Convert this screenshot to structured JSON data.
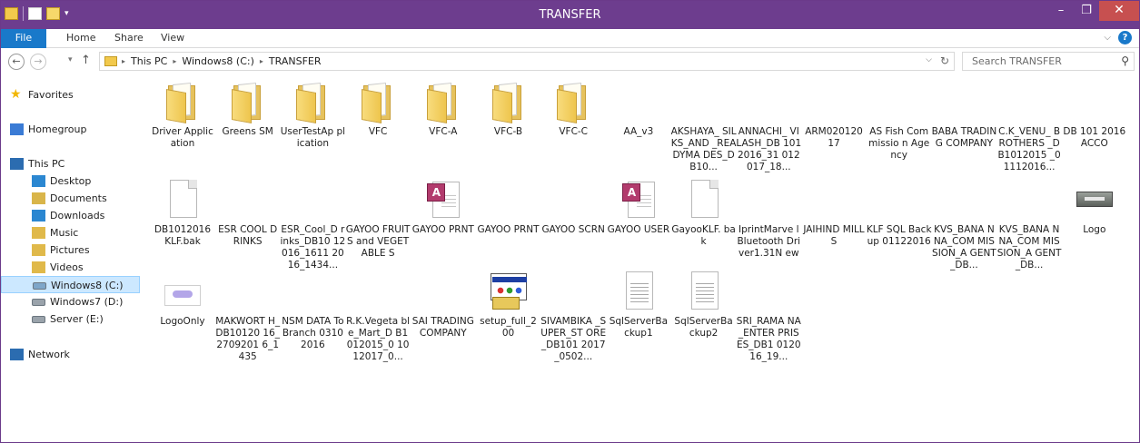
{
  "window": {
    "title": "TRANSFER",
    "minimize_glyph": "–",
    "maximize_glyph": "❐",
    "close_glyph": "✕"
  },
  "ribbon": {
    "file": "File",
    "tabs": [
      "Home",
      "Share",
      "View"
    ],
    "expand_glyph": "⌵",
    "help_glyph": "?"
  },
  "nav": {
    "back_glyph": "←",
    "forward_glyph": "→",
    "recent_glyph": "▾",
    "up_glyph": "↑"
  },
  "address": {
    "crumbs": [
      "This PC",
      "Windows8 (C:)",
      "TRANSFER"
    ],
    "separator_glyph": "▸",
    "dropdown_glyph": "⌵",
    "refresh_glyph": "↻"
  },
  "search": {
    "placeholder": "Search TRANSFER",
    "icon_glyph": "⚲"
  },
  "sidebar": {
    "items": [
      {
        "label": "Favorites",
        "icon": "star-icon",
        "color": "#f2b705"
      },
      {
        "label": "Homegroup",
        "icon": "homegroup-icon",
        "color": "#3a7bd5"
      },
      {
        "label": "This PC",
        "icon": "computer-icon",
        "color": "#2b6cb0"
      },
      {
        "label": "Desktop",
        "icon": "desktop-icon",
        "color": "#2b87d1"
      },
      {
        "label": "Documents",
        "icon": "documents-icon",
        "color": "#d9b54a"
      },
      {
        "label": "Downloads",
        "icon": "downloads-icon",
        "color": "#2b87d1"
      },
      {
        "label": "Music",
        "icon": "music-icon",
        "color": "#e0b94a"
      },
      {
        "label": "Pictures",
        "icon": "pictures-icon",
        "color": "#e0b94a"
      },
      {
        "label": "Videos",
        "icon": "videos-icon",
        "color": "#e0b94a"
      },
      {
        "label": "Windows8 (C:)",
        "icon": "drive-icon",
        "color": "#7fa6c9",
        "selected": true
      },
      {
        "label": "Windows7 (D:)",
        "icon": "drive-icon",
        "color": "#9aa3ab"
      },
      {
        "label": "Server (E:)",
        "icon": "drive-icon",
        "color": "#9aa3ab"
      },
      {
        "label": "Network",
        "icon": "network-icon",
        "color": "#2b6cb0"
      }
    ]
  },
  "files": [
    {
      "name": "Driver Application",
      "type": "folder"
    },
    {
      "name": "Greens SM",
      "type": "folder"
    },
    {
      "name": "UserTestAp plication",
      "type": "folder"
    },
    {
      "name": "VFC",
      "type": "folder"
    },
    {
      "name": "VFC-A",
      "type": "folder"
    },
    {
      "name": "VFC-B",
      "type": "folder"
    },
    {
      "name": "VFC-C",
      "type": "folder"
    },
    {
      "name": "AA_v3",
      "type": "archive"
    },
    {
      "name": "AKSHAYA_ SILKS_AND _READYMA DES_DB10...",
      "type": "archive"
    },
    {
      "name": "ANNACHI_ VILASH_DB 1012016_31 012017_18...",
      "type": "archive"
    },
    {
      "name": "ARM020120 17",
      "type": "archive"
    },
    {
      "name": "AS Fish Commissio n Agency",
      "type": "archive"
    },
    {
      "name": "BABA TRADING COMPANY",
      "type": "archive"
    },
    {
      "name": "C.K_VENU_ BROTHERS _DB1012015 _01112016...",
      "type": "archive"
    },
    {
      "name": "DB 101 2016 ACCO",
      "type": "archive"
    },
    {
      "name": "DB1012016 KLF.bak",
      "type": "bak"
    },
    {
      "name": "ESR COOL DRINKS",
      "type": "archive"
    },
    {
      "name": "ESR_Cool_D rinks_DB10 12016_1611 2016_1434...",
      "type": "archive"
    },
    {
      "name": "GAYOO FRUITS and VEGETABLE S",
      "type": "archive"
    },
    {
      "name": "GAYOO PRNT",
      "type": "access"
    },
    {
      "name": "GAYOO PRNT",
      "type": "archive"
    },
    {
      "name": "GAYOO SCRN",
      "type": "archive"
    },
    {
      "name": "GAYOO USER",
      "type": "access"
    },
    {
      "name": "GayooKLF. bak",
      "type": "bak"
    },
    {
      "name": "IprintMarve lBluetooth Driver1.31N ew",
      "type": "archive"
    },
    {
      "name": "JAIHIND MILLS",
      "type": "archive"
    },
    {
      "name": "KLF SQL Backup 01122016",
      "type": "archive"
    },
    {
      "name": "KVS_BANA NNA_COM MISSION_A GENT_DB...",
      "type": "archive"
    },
    {
      "name": "KVS_BANA NNA_COM MISSION_A GENT_DB...",
      "type": "archive"
    },
    {
      "name": "Logo",
      "type": "logo"
    },
    {
      "name": "LogoOnly",
      "type": "logoonly"
    },
    {
      "name": "MAKWORT H_DB10120 16_2709201 6_1435",
      "type": "archive"
    },
    {
      "name": "NSM DATA To Branch 03102016",
      "type": "archive"
    },
    {
      "name": "R.K.Vegeta ble_Mart_D B1012015_0 1012017_0...",
      "type": "archive"
    },
    {
      "name": "SAI TRADING COMPANY",
      "type": "archive"
    },
    {
      "name": "setup_full_2 00",
      "type": "setup"
    },
    {
      "name": "SIVAMBIKA _SUPER_ST ORE_DB101 2017_0502...",
      "type": "archive"
    },
    {
      "name": "SqlServerBa ckup1",
      "type": "txt"
    },
    {
      "name": "SqlServerBa ckup2",
      "type": "txt"
    },
    {
      "name": "SRI_RAMA NA_ENTER PRISES_DB1 012016_19...",
      "type": "archive"
    }
  ]
}
